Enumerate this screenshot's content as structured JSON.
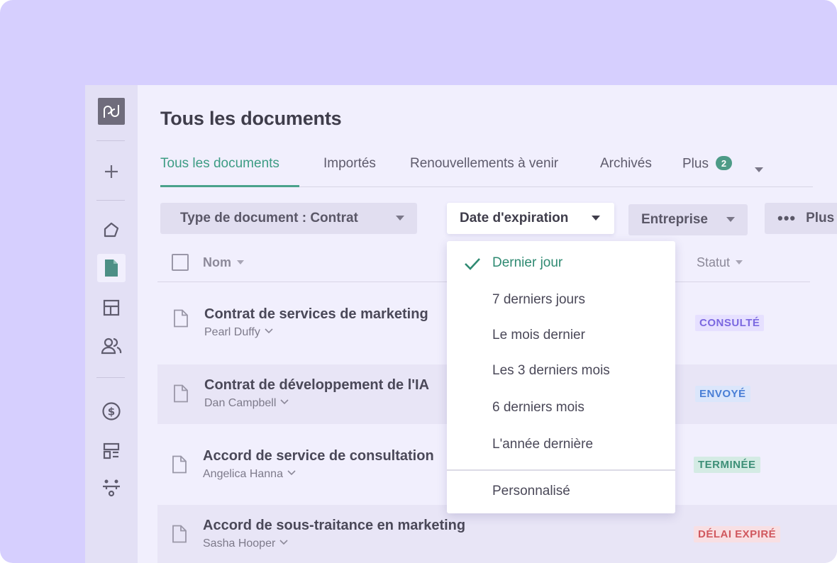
{
  "sidebar": {
    "logo_text": "pd",
    "icons": [
      "plus-icon",
      "home-icon",
      "document-icon",
      "template-icon",
      "contacts-icon",
      "dollar-icon",
      "catalog-icon",
      "workspace-icon"
    ]
  },
  "page": {
    "title": "Tous les documents"
  },
  "tabs": [
    {
      "label": "Tous les documents",
      "active": true
    },
    {
      "label": "Importés"
    },
    {
      "label": "Renouvellements à venir"
    },
    {
      "label": "Archivés"
    },
    {
      "label": "Plus",
      "badge": "2"
    }
  ],
  "filters": {
    "doc_type": "Type de document : Contrat",
    "expiration": "Date d'expiration",
    "company": "Entreprise",
    "more": "Plus"
  },
  "table": {
    "col_name": "Nom",
    "col_status": "Statut",
    "rows": [
      {
        "title": "Contrat de services de marketing",
        "owner": "Pearl Duffy",
        "status": "CONSULTÉ",
        "status_color": "#7b68e0",
        "status_bg": "#e6e0ff"
      },
      {
        "title": "Contrat de développement de l'IA",
        "owner": "Dan Campbell",
        "status": "ENVOYÉ",
        "status_color": "#4a7fd6",
        "status_bg": "#dbe6fb"
      },
      {
        "title": "Accord de service de consultation",
        "owner": "Angelica Hanna",
        "status": "TERMINÉE",
        "status_color": "#3d8f77",
        "status_bg": "#d4ebe4"
      },
      {
        "title": "Accord de sous-traitance en marketing",
        "owner": "Sasha Hooper",
        "status": "DÉLAI EXPIRÉ",
        "status_color": "#d0585e",
        "status_bg": "#f8dfe3"
      }
    ]
  },
  "dropdown": {
    "options": [
      "Dernier jour",
      "7 derniers jours",
      "Le mois dernier",
      "Les 3 derniers mois",
      "6 derniers mois",
      "L'année dernière"
    ],
    "selected": "Dernier jour",
    "custom": "Personnalisé"
  },
  "colors": {
    "accent": "#3d9c84",
    "frame": "#d6cffe",
    "app_bg": "#f1effd"
  }
}
